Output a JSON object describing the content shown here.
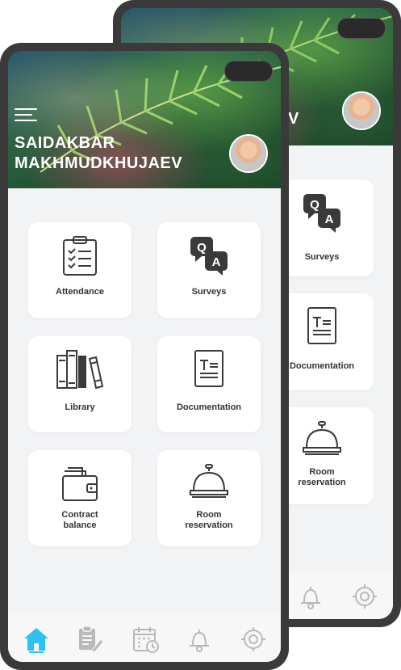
{
  "user": {
    "name_line1": "SAIDAKBAR",
    "name_line2": "MAKHMUDKHUJAEV",
    "back_name_fragment": "V"
  },
  "tiles": [
    {
      "label_line1": "Attendance",
      "label_line2": "",
      "icon": "clipboard-checklist-icon"
    },
    {
      "label_line1": "Surveys",
      "label_line2": "",
      "icon": "qa-bubbles-icon"
    },
    {
      "label_line1": "Library",
      "label_line2": "",
      "icon": "books-icon"
    },
    {
      "label_line1": "Documentation",
      "label_line2": "",
      "icon": "document-icon"
    },
    {
      "label_line1": "Contract",
      "label_line2": "balance",
      "icon": "wallet-icon"
    },
    {
      "label_line1": "Room",
      "label_line2": "reservation",
      "icon": "service-bell-icon"
    }
  ],
  "nav": [
    {
      "name": "home",
      "icon": "home-icon",
      "active": true
    },
    {
      "name": "tasks",
      "icon": "clipboard-edit-icon",
      "active": false
    },
    {
      "name": "calendar",
      "icon": "calendar-clock-icon",
      "active": false
    },
    {
      "name": "notifications",
      "icon": "bell-icon",
      "active": false
    },
    {
      "name": "settings",
      "icon": "settings-icon",
      "active": false
    }
  ],
  "colors": {
    "accent": "#2ec0f0",
    "icon_gray": "#3a3a3a",
    "nav_inactive": "#b9b9b9"
  }
}
